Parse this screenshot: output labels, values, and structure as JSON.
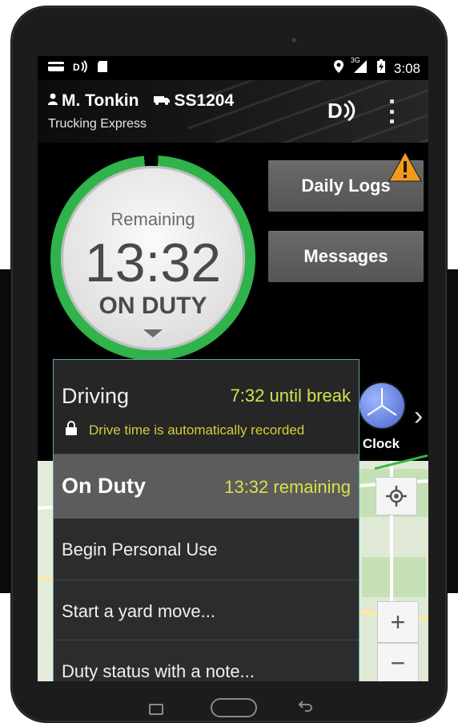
{
  "status_bar": {
    "time": "3:08",
    "network": "3G",
    "icons": [
      "bank-card-icon",
      "signal-wireless-icon",
      "sd-card-icon",
      "location-pin-icon",
      "cell-signal-icon",
      "battery-charging-icon"
    ]
  },
  "header": {
    "driver_name": "M. Tonkin",
    "truck_id": "SS1204",
    "company": "Trucking Express",
    "icons": [
      "person-icon",
      "truck-icon",
      "device-connected-icon",
      "overflow-menu-icon"
    ]
  },
  "dial": {
    "label": "Remaining",
    "time": "13:32",
    "status": "ON DUTY",
    "ring_color": "#2fb34a"
  },
  "buttons": {
    "daily_logs": "Daily Logs",
    "messages": "Messages",
    "warning_color": "#f39a1a"
  },
  "clock": {
    "label": "Clock"
  },
  "menu": {
    "driving": {
      "label": "Driving",
      "detail": "7:32 until break",
      "note": "Drive time is automatically recorded"
    },
    "on_duty": {
      "label": "On Duty",
      "detail": "13:32 remaining"
    },
    "items": [
      "Begin Personal Use",
      "Start a yard move...",
      "Duty status with a note..."
    ],
    "accent_color": "#d6e24a"
  },
  "map": {
    "zoom_in": "+",
    "zoom_out": "−"
  }
}
